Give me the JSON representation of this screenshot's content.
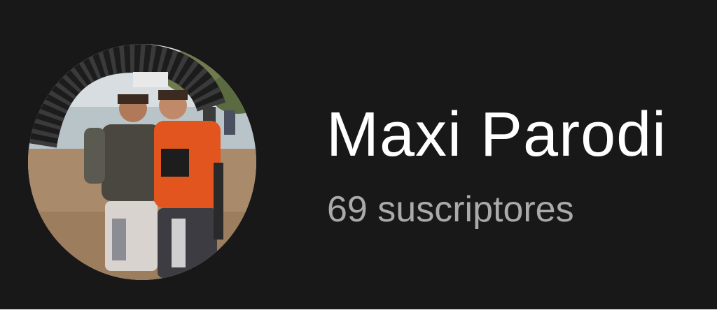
{
  "channel": {
    "name": "Maxi Parodi",
    "subscribers": "69 suscriptores",
    "avatar_alt": "channel-avatar-photo"
  },
  "colors": {
    "background": "#181818",
    "name_text": "#ffffff",
    "subscriber_text": "#aaaaaa"
  }
}
